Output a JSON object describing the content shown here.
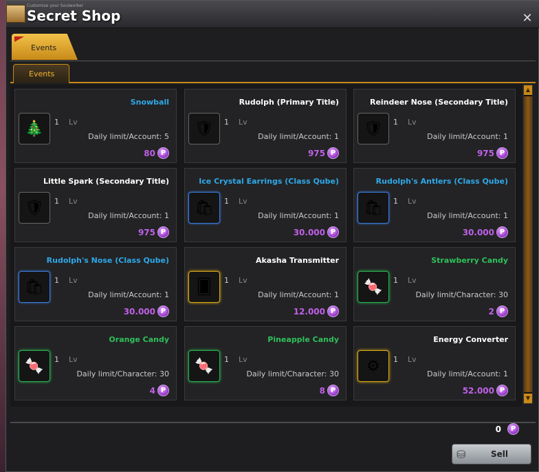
{
  "window": {
    "subtitle": "Customize your Soulworker",
    "title": "Secret Shop",
    "close_glyph": "✕"
  },
  "tabs": {
    "main": "Events",
    "sub": "Events"
  },
  "items": [
    {
      "name": "Snowball",
      "color": "blue",
      "icon": "snow-globe-icon",
      "glyph": "🎄",
      "frame": "plain",
      "qty": "1",
      "lv": "Lv",
      "limit": "Daily limit/Account: 5",
      "price": "80"
    },
    {
      "name": "Rudolph (Primary Title)",
      "color": "white",
      "icon": "title-emblem-icon",
      "glyph": "🛡",
      "frame": "plain",
      "qty": "1",
      "lv": "Lv",
      "limit": "Daily limit/Account: 1",
      "price": "975"
    },
    {
      "name": "Reindeer Nose (Secondary Title)",
      "color": "white",
      "icon": "title-emblem-icon",
      "glyph": "🛡",
      "frame": "plain",
      "qty": "1",
      "lv": "Lv",
      "limit": "Daily limit/Account: 1",
      "price": "975"
    },
    {
      "name": "Little Spark (Secondary Title)",
      "color": "white",
      "icon": "title-emblem-icon",
      "glyph": "🛡",
      "frame": "plain",
      "qty": "1",
      "lv": "Lv",
      "limit": "Daily limit/Account: 1",
      "price": "975"
    },
    {
      "name": "Ice Crystal Earrings (Class Qube)",
      "color": "blue",
      "icon": "shopping-bag-icon",
      "glyph": "🛍",
      "frame": "blue",
      "qty": "1",
      "lv": "Lv",
      "limit": "Daily limit/Account: 1",
      "price": "30.000"
    },
    {
      "name": "Rudolph's Antlers (Class Qube)",
      "color": "blue",
      "icon": "shopping-bag-icon",
      "glyph": "🛍",
      "frame": "blue",
      "qty": "1",
      "lv": "Lv",
      "limit": "Daily limit/Account: 1",
      "price": "30.000"
    },
    {
      "name": "Rudolph's Nose (Class Qube)",
      "color": "blue",
      "icon": "shopping-bag-icon",
      "glyph": "🛍",
      "frame": "blue",
      "qty": "1",
      "lv": "Lv",
      "limit": "Daily limit/Account: 1",
      "price": "30.000"
    },
    {
      "name": "Akasha Transmitter",
      "color": "white",
      "icon": "akasha-card-icon",
      "glyph": "🂠",
      "frame": "gold",
      "qty": "1",
      "lv": "Lv",
      "limit": "Daily limit/Account: 1",
      "price": "12.000"
    },
    {
      "name": "Strawberry Candy",
      "color": "green",
      "icon": "candy-icon",
      "glyph": "🍬",
      "frame": "green",
      "qty": "1",
      "lv": "Lv",
      "limit": "Daily limit/Character: 30",
      "price": "2"
    },
    {
      "name": "Orange Candy",
      "color": "green",
      "icon": "candy-icon",
      "glyph": "🍬",
      "frame": "green",
      "qty": "1",
      "lv": "Lv",
      "limit": "Daily limit/Character: 30",
      "price": "4"
    },
    {
      "name": "Pineapple Candy",
      "color": "green",
      "icon": "candy-icon",
      "glyph": "🍬",
      "frame": "green",
      "qty": "1",
      "lv": "Lv",
      "limit": "Daily limit/Character: 30",
      "price": "8"
    },
    {
      "name": "Energy Converter",
      "color": "white",
      "icon": "energy-converter-icon",
      "glyph": "⚙",
      "frame": "gold",
      "qty": "1",
      "lv": "Lv",
      "limit": "Daily limit/Account: 1",
      "price": "52.000"
    }
  ],
  "coin_glyph": "P",
  "footer": {
    "balance": "0",
    "sell_label": "Sell",
    "sell_icon": "coin-stack-icon"
  }
}
